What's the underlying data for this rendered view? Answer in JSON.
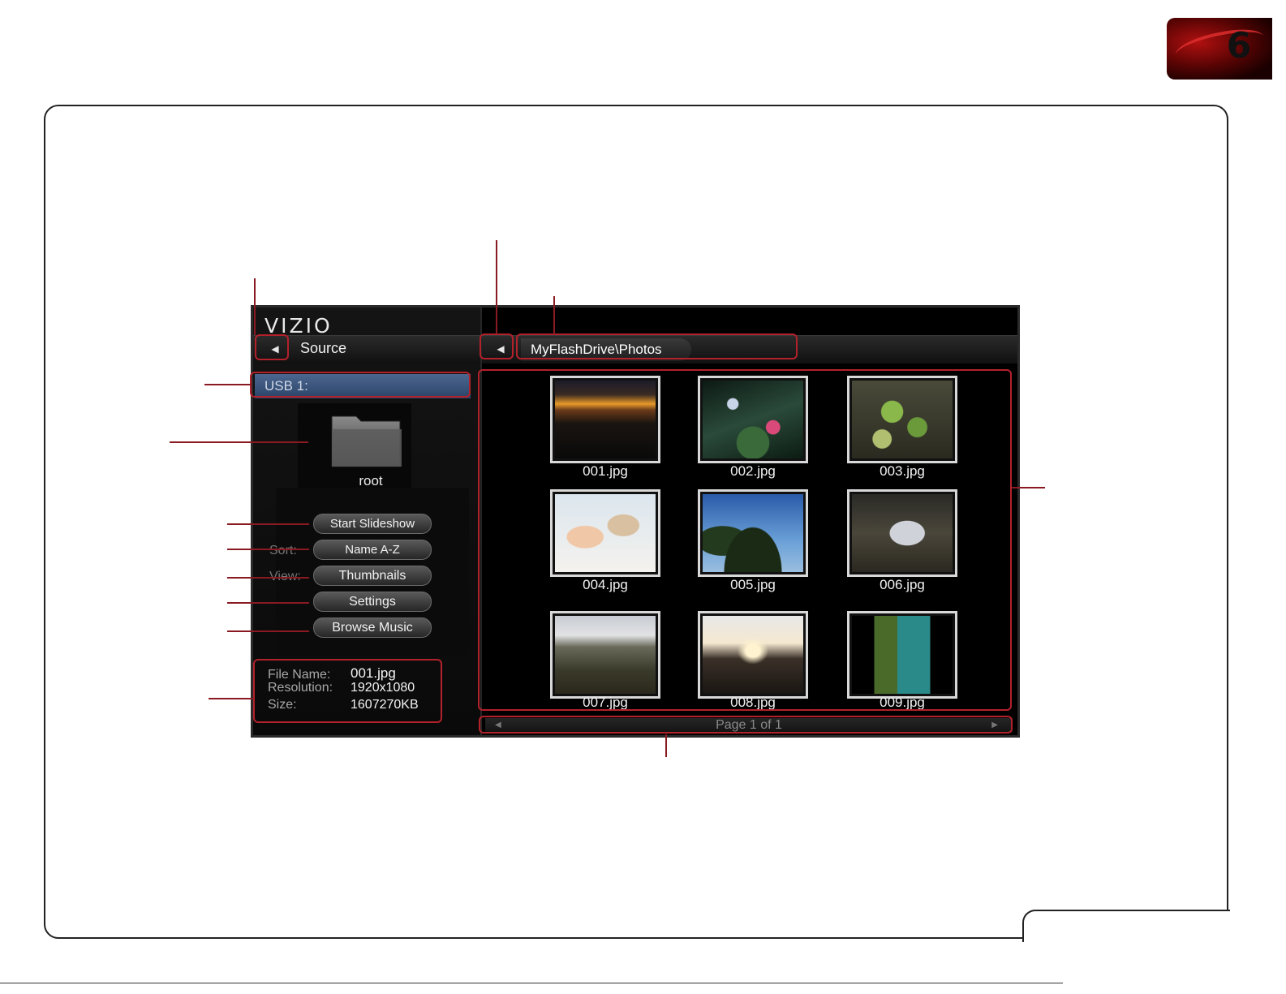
{
  "badge": {
    "chapter_number": "6"
  },
  "tv": {
    "brand": "VIZIO",
    "left_header": {
      "back_icon": "left-triangle",
      "label": "Source"
    },
    "right_header": {
      "back_icon": "left-triangle",
      "path": "MyFlashDrive\\Photos"
    },
    "device": "USB 1:",
    "folder": {
      "icon": "folder-icon",
      "label": "root"
    },
    "controls": {
      "slideshow": "Start Slideshow",
      "sort_label": "Sort:",
      "sort_value": "Name A-Z",
      "view_label": "View:",
      "view_value": "Thumbnails",
      "settings": "Settings",
      "browse_music": "Browse Music"
    },
    "file_info": {
      "name_label": "File Name:",
      "name_value": "001.jpg",
      "res_label": "Resolution:",
      "res_value": "1920x1080",
      "size_label": "Size:",
      "size_value": "1607270KB"
    },
    "thumbnails": [
      {
        "label": "001.jpg"
      },
      {
        "label": "002.jpg"
      },
      {
        "label": "003.jpg"
      },
      {
        "label": "004.jpg"
      },
      {
        "label": "005.jpg"
      },
      {
        "label": "006.jpg"
      },
      {
        "label": "007.jpg"
      },
      {
        "label": "008.jpg"
      },
      {
        "label": "009.jpg"
      }
    ],
    "page_indicator": "Page 1 of 1"
  },
  "colors": {
    "callout": "#b3212b",
    "usb_highlight": "#3d5a86"
  }
}
